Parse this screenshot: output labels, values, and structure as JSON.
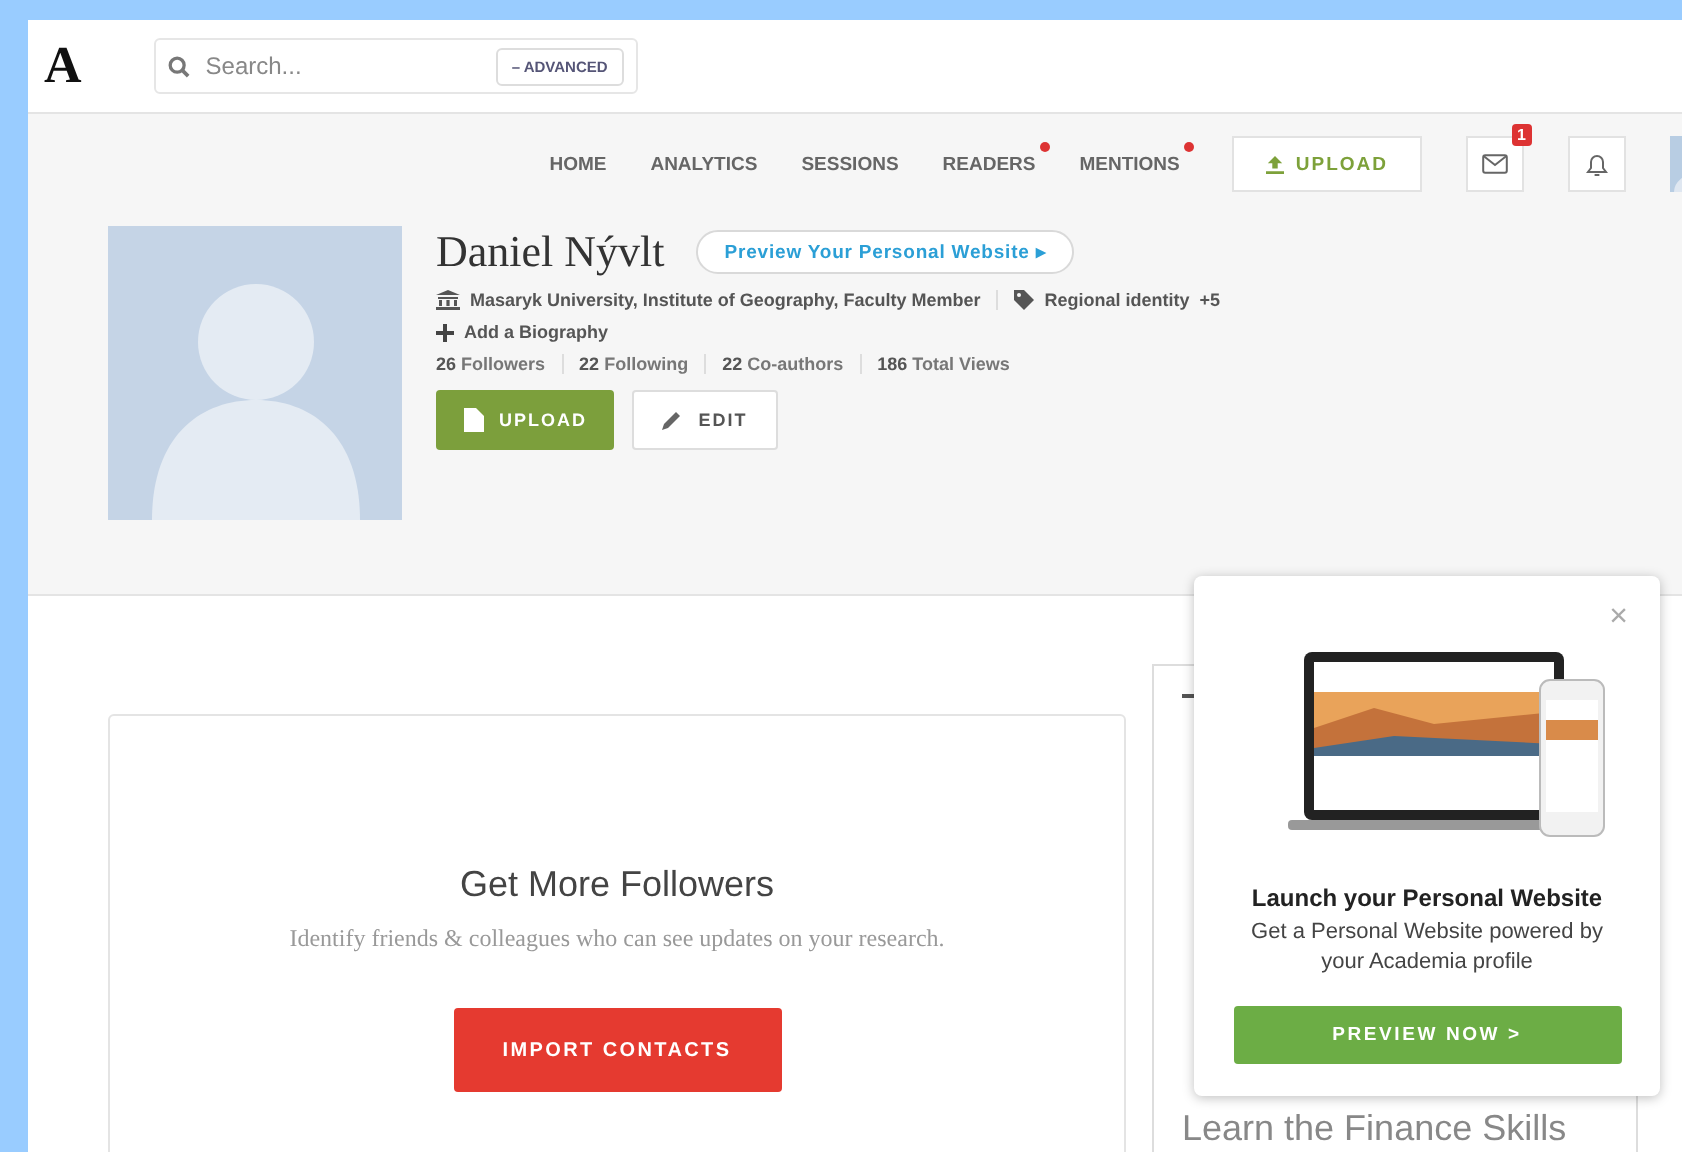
{
  "logo": "A",
  "search": {
    "placeholder": "Search...",
    "advanced": "ADVANCED",
    "advanced_mark": "–"
  },
  "nav": [
    {
      "label": "HOME",
      "dot": false
    },
    {
      "label": "ANALYTICS",
      "dot": false
    },
    {
      "label": "SESSIONS",
      "dot": false
    },
    {
      "label": "READERS",
      "dot": true
    },
    {
      "label": "MENTIONS",
      "dot": true
    }
  ],
  "top_upload": "UPLOAD",
  "mail_badge": "1",
  "profile": {
    "name": "Daniel Nývlt",
    "preview": "Preview Your Personal Website",
    "preview_arrow": "▸",
    "affiliation": "Masaryk University, Institute of Geography, Faculty Member",
    "interest": "Regional identity",
    "interest_more": "+5",
    "bio": "Add a Biography",
    "stats": [
      {
        "count": "26",
        "label": "Followers"
      },
      {
        "count": "22",
        "label": "Following"
      },
      {
        "count": "22",
        "label": "Co-authors"
      },
      {
        "count": "186",
        "label": "Total Views"
      }
    ],
    "upload": "UPLOAD",
    "edit": "EDIT"
  },
  "followers_card": {
    "title": "Get More Followers",
    "text": "Identify friends & colleagues who can see updates on your research.",
    "button": "IMPORT CONTACTS"
  },
  "ad": {
    "caption": "Learn the Finance Skills"
  },
  "popup": {
    "title": "Launch your Personal Website",
    "text": "Get a Personal Website powered by your Academia profile",
    "button": "PREVIEW NOW >",
    "close": "×"
  }
}
